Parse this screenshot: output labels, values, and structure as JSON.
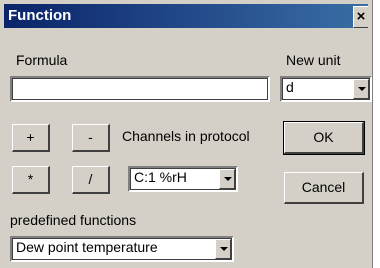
{
  "window": {
    "title": "Function",
    "close_glyph": "×"
  },
  "formula": {
    "label": "Formula",
    "value": ""
  },
  "new_unit": {
    "label": "New unit",
    "selected": "d"
  },
  "operators": {
    "add": "+",
    "subtract": "-",
    "multiply": "*",
    "divide": "/"
  },
  "channels": {
    "label": "Channels in protocol",
    "selected": "C:1 %rH"
  },
  "buttons": {
    "ok": "OK",
    "cancel": "Cancel"
  },
  "predefined": {
    "label": "predefined functions",
    "selected": "Dew point temperature"
  },
  "icons": {
    "close": "close-icon",
    "dropdown": "chevron-down-icon"
  }
}
